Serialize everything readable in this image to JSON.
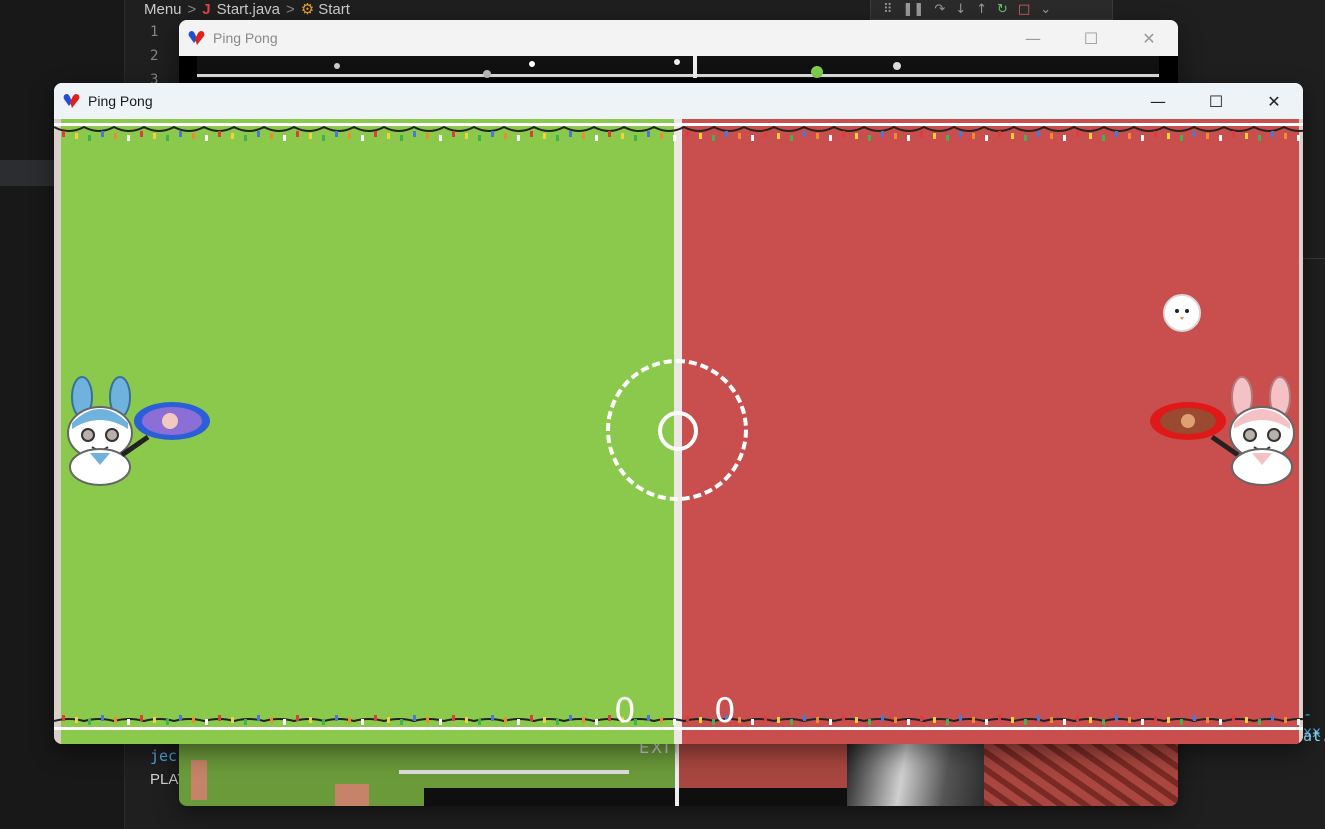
{
  "ide": {
    "breadcrumb": {
      "menu": "Menu",
      "file": "Start.java",
      "file_icon": "J",
      "class": "Start"
    },
    "gutter_lines": [
      "1",
      "2",
      "3"
    ],
    "code_bottom_left_1": "jec",
    "code_bottom_left_2": "PLAY",
    "code_right_1": "-xx",
    "code_right_2": "at."
  },
  "windows": {
    "back": {
      "title": "Ping Pong",
      "exit_text": "EXIT"
    },
    "front": {
      "title": "Ping Pong"
    }
  },
  "game": {
    "score_left": "0",
    "score_right": "0",
    "colors": {
      "left_half": "#8bc94d",
      "right_half": "#c84f4d",
      "lines": "#ffffff"
    },
    "left_player": {
      "character": "blue-bunny",
      "paddle": "blue-paddle"
    },
    "right_player": {
      "character": "pink-bunny",
      "paddle": "red-paddle"
    },
    "ball": "snowball-face"
  }
}
